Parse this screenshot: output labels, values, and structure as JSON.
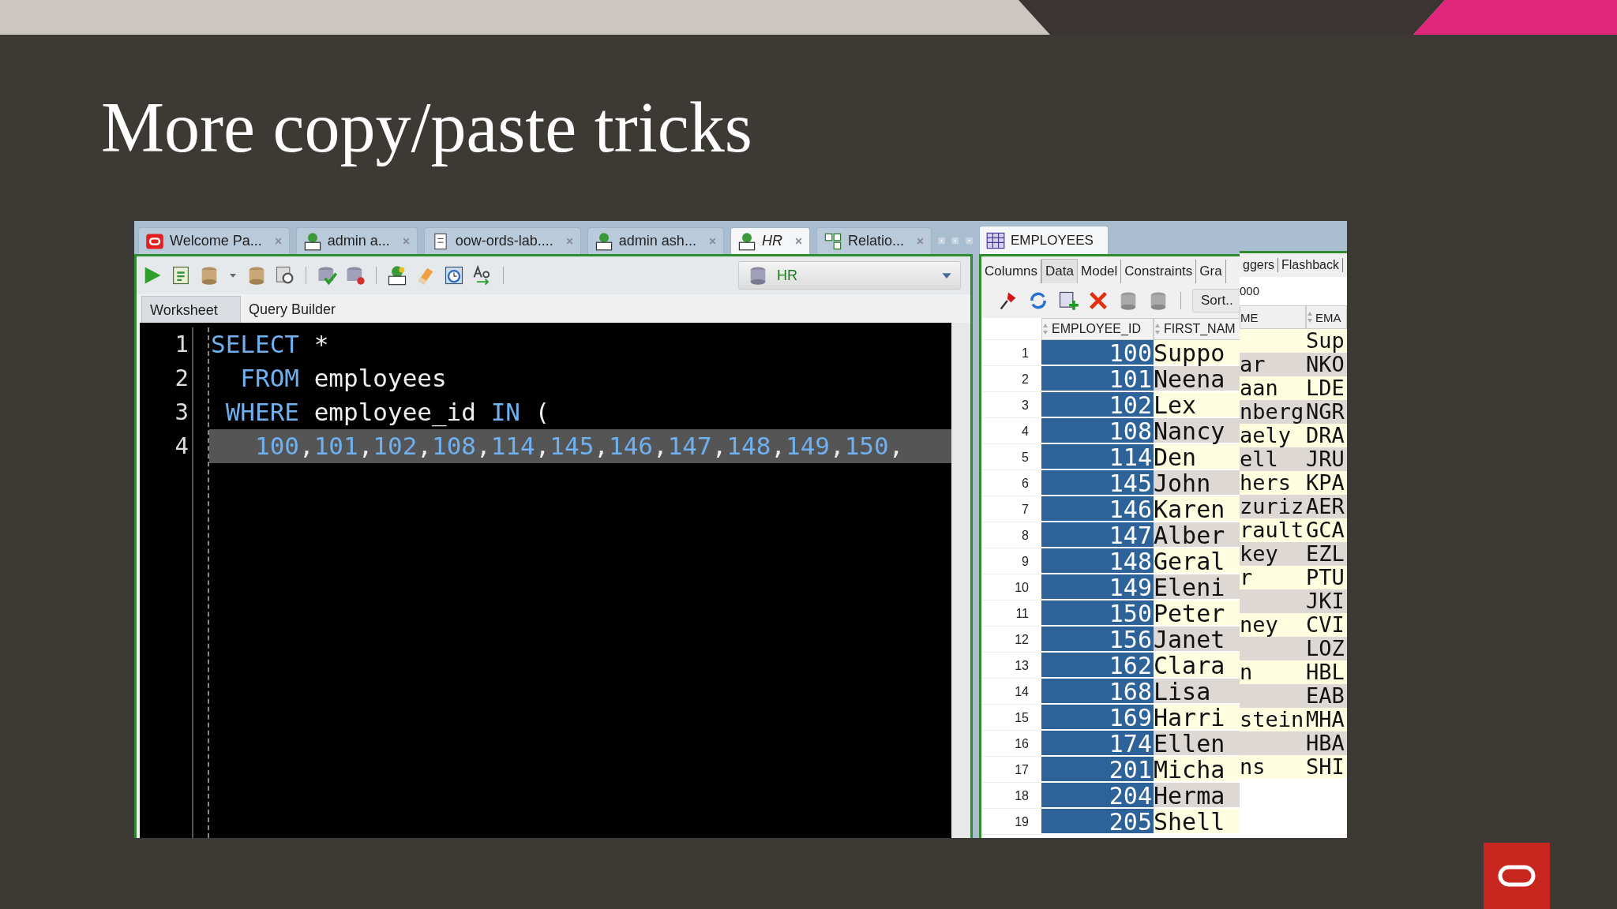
{
  "slide": {
    "title": "More copy/paste tricks"
  },
  "editor_window": {
    "tabs": [
      {
        "label": "Welcome Pa...",
        "kind": "oracle",
        "selected": false
      },
      {
        "label": "admin a...",
        "kind": "sql",
        "selected": false
      },
      {
        "label": "oow-ords-lab....",
        "kind": "file",
        "selected": false
      },
      {
        "label": "admin ash...",
        "kind": "sql",
        "selected": false
      },
      {
        "label": "HR",
        "kind": "sql",
        "selected": true
      },
      {
        "label": "Relatio...",
        "kind": "model",
        "selected": false
      }
    ],
    "connection": "HR",
    "subtabs": [
      {
        "label": "Worksheet",
        "selected": true
      },
      {
        "label": "Query Builder",
        "selected": false
      }
    ],
    "lines": [
      {
        "number": "1",
        "highlighted": false,
        "segments": [
          {
            "text": "SELECT",
            "kind": "keyword"
          },
          {
            "text": " *",
            "kind": "plain"
          }
        ]
      },
      {
        "number": "2",
        "highlighted": false,
        "segments": [
          {
            "text": "  FROM",
            "kind": "keyword"
          },
          {
            "text": " employees",
            "kind": "plain"
          }
        ]
      },
      {
        "number": "3",
        "highlighted": false,
        "segments": [
          {
            "text": " WHERE",
            "kind": "keyword"
          },
          {
            "text": " employee_id ",
            "kind": "plain"
          },
          {
            "text": "IN",
            "kind": "keyword"
          },
          {
            "text": " (",
            "kind": "plain"
          }
        ]
      },
      {
        "number": "4",
        "highlighted": true,
        "segments": [
          {
            "text": "   100",
            "kind": "number"
          },
          {
            "text": ",",
            "kind": "plain"
          },
          {
            "text": "101",
            "kind": "number"
          },
          {
            "text": ",",
            "kind": "plain"
          },
          {
            "text": "102",
            "kind": "number"
          },
          {
            "text": ",",
            "kind": "plain"
          },
          {
            "text": "108",
            "kind": "number"
          },
          {
            "text": ",",
            "kind": "plain"
          },
          {
            "text": "114",
            "kind": "number"
          },
          {
            "text": ",",
            "kind": "plain"
          },
          {
            "text": "145",
            "kind": "number"
          },
          {
            "text": ",",
            "kind": "plain"
          },
          {
            "text": "146",
            "kind": "number"
          },
          {
            "text": ",",
            "kind": "plain"
          },
          {
            "text": "147",
            "kind": "number"
          },
          {
            "text": ",",
            "kind": "plain"
          },
          {
            "text": "148",
            "kind": "number"
          },
          {
            "text": ",",
            "kind": "plain"
          },
          {
            "text": "149",
            "kind": "number"
          },
          {
            "text": ",",
            "kind": "plain"
          },
          {
            "text": "150",
            "kind": "number"
          },
          {
            "text": ",",
            "kind": "plain"
          }
        ]
      }
    ]
  },
  "table_window": {
    "tab": {
      "label": "EMPLOYEES",
      "selected": true
    },
    "subtabs": [
      {
        "label": "Columns",
        "selected": false
      },
      {
        "label": "Data",
        "selected": true
      },
      {
        "label": "Model",
        "selected": false
      },
      {
        "label": "Constraints",
        "selected": false
      },
      {
        "label": "Gra",
        "selected": false
      }
    ],
    "sort_button": "Sort..",
    "columns": [
      {
        "label": "EMPLOYEE_ID",
        "selected": true
      },
      {
        "label": "FIRST_NAM",
        "selected": false
      }
    ],
    "rows": [
      {
        "number": "1",
        "cells": [
          "100",
          "Suppo"
        ]
      },
      {
        "number": "2",
        "cells": [
          "101",
          "Neena"
        ]
      },
      {
        "number": "3",
        "cells": [
          "102",
          "Lex"
        ]
      },
      {
        "number": "4",
        "cells": [
          "108",
          "Nancy"
        ]
      },
      {
        "number": "5",
        "cells": [
          "114",
          "Den"
        ]
      },
      {
        "number": "6",
        "cells": [
          "145",
          "John"
        ]
      },
      {
        "number": "7",
        "cells": [
          "146",
          "Karen"
        ]
      },
      {
        "number": "8",
        "cells": [
          "147",
          "Alber"
        ]
      },
      {
        "number": "9",
        "cells": [
          "148",
          "Geral"
        ]
      },
      {
        "number": "10",
        "cells": [
          "149",
          "Eleni"
        ]
      },
      {
        "number": "11",
        "cells": [
          "150",
          "Peter"
        ]
      },
      {
        "number": "12",
        "cells": [
          "156",
          "Janet"
        ]
      },
      {
        "number": "13",
        "cells": [
          "162",
          "Clara"
        ]
      },
      {
        "number": "14",
        "cells": [
          "168",
          "Lisa"
        ]
      },
      {
        "number": "15",
        "cells": [
          "169",
          "Harri"
        ]
      },
      {
        "number": "16",
        "cells": [
          "174",
          "Ellen"
        ]
      },
      {
        "number": "17",
        "cells": [
          "201",
          "Micha"
        ]
      },
      {
        "number": "18",
        "cells": [
          "204",
          "Herma"
        ]
      },
      {
        "number": "19",
        "cells": [
          "205",
          "Shell"
        ]
      }
    ]
  },
  "overlay_window": {
    "tabs": [
      "ggers",
      "Flashback"
    ],
    "filter": "000",
    "columns": [
      "ME",
      "EMA"
    ],
    "rows": [
      {
        "column_1": "",
        "column_2": "Sup"
      },
      {
        "column_1": "ar",
        "column_2": "NKO"
      },
      {
        "column_1": "aan",
        "column_2": "LDE"
      },
      {
        "column_1": "nberg",
        "column_2": "NGR"
      },
      {
        "column_1": "aely",
        "column_2": "DRA"
      },
      {
        "column_1": "ell",
        "column_2": "JRU"
      },
      {
        "column_1": "hers",
        "column_2": "KPA"
      },
      {
        "column_1": "zuriz",
        "column_2": "AER"
      },
      {
        "column_1": "rault",
        "column_2": "GCA"
      },
      {
        "column_1": "key",
        "column_2": "EZL"
      },
      {
        "column_1": "r",
        "column_2": "PTU"
      },
      {
        "column_1": "",
        "column_2": "JKI"
      },
      {
        "column_1": "ney",
        "column_2": "CVI"
      },
      {
        "column_1": "",
        "column_2": "LOZ"
      },
      {
        "column_1": "n",
        "column_2": "HBL"
      },
      {
        "column_1": "",
        "column_2": "EAB"
      },
      {
        "column_1": "stein",
        "column_2": "MHA"
      },
      {
        "column_1": "",
        "column_2": "HBA"
      },
      {
        "column_1": "ns",
        "column_2": "SHI"
      }
    ]
  }
}
